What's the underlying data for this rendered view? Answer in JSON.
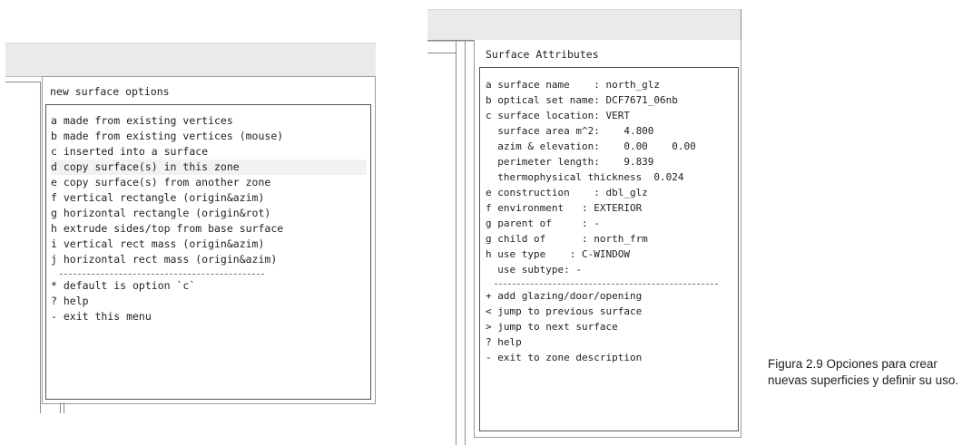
{
  "left_window": {
    "title": "new surface options",
    "options": [
      "a made from existing vertices",
      "b made from existing vertices (mouse)",
      "c inserted into a surface",
      "d copy surface(s) in this zone",
      "e copy surface(s) from another zone",
      "f vertical rectangle (origin&azim)",
      "g horizontal rectangle (origin&rot)",
      "h extrude sides/top from base surface",
      "i vertical rect mass (origin&azim)",
      "j horizontal rect mass (origin&azim)"
    ],
    "footer": [
      "* default is option `c`",
      "? help",
      "- exit this menu"
    ]
  },
  "right_window": {
    "title": "Surface Attributes",
    "fields": [
      "a surface name    : north_glz",
      "b optical set name: DCF7671_06nb",
      "c surface location: VERT",
      "  surface area m^2:    4.800",
      "  azim & elevation:    0.00    0.00",
      "  perimeter length:    9.839",
      "  thermophysical thickness  0.024",
      "e construction    : dbl_glz",
      "f environment   : EXTERIOR",
      "g parent of     : -",
      "g child of      : north_frm",
      "h use type    : C-WINDOW",
      "  use subtype: -"
    ],
    "footer": [
      "+ add glazing/door/opening",
      "< jump to previous surface",
      "> jump to next surface",
      "? help",
      "- exit to zone description"
    ]
  },
  "caption": "Figura 2.9 Opciones para crear nuevas superficies y definir su uso."
}
